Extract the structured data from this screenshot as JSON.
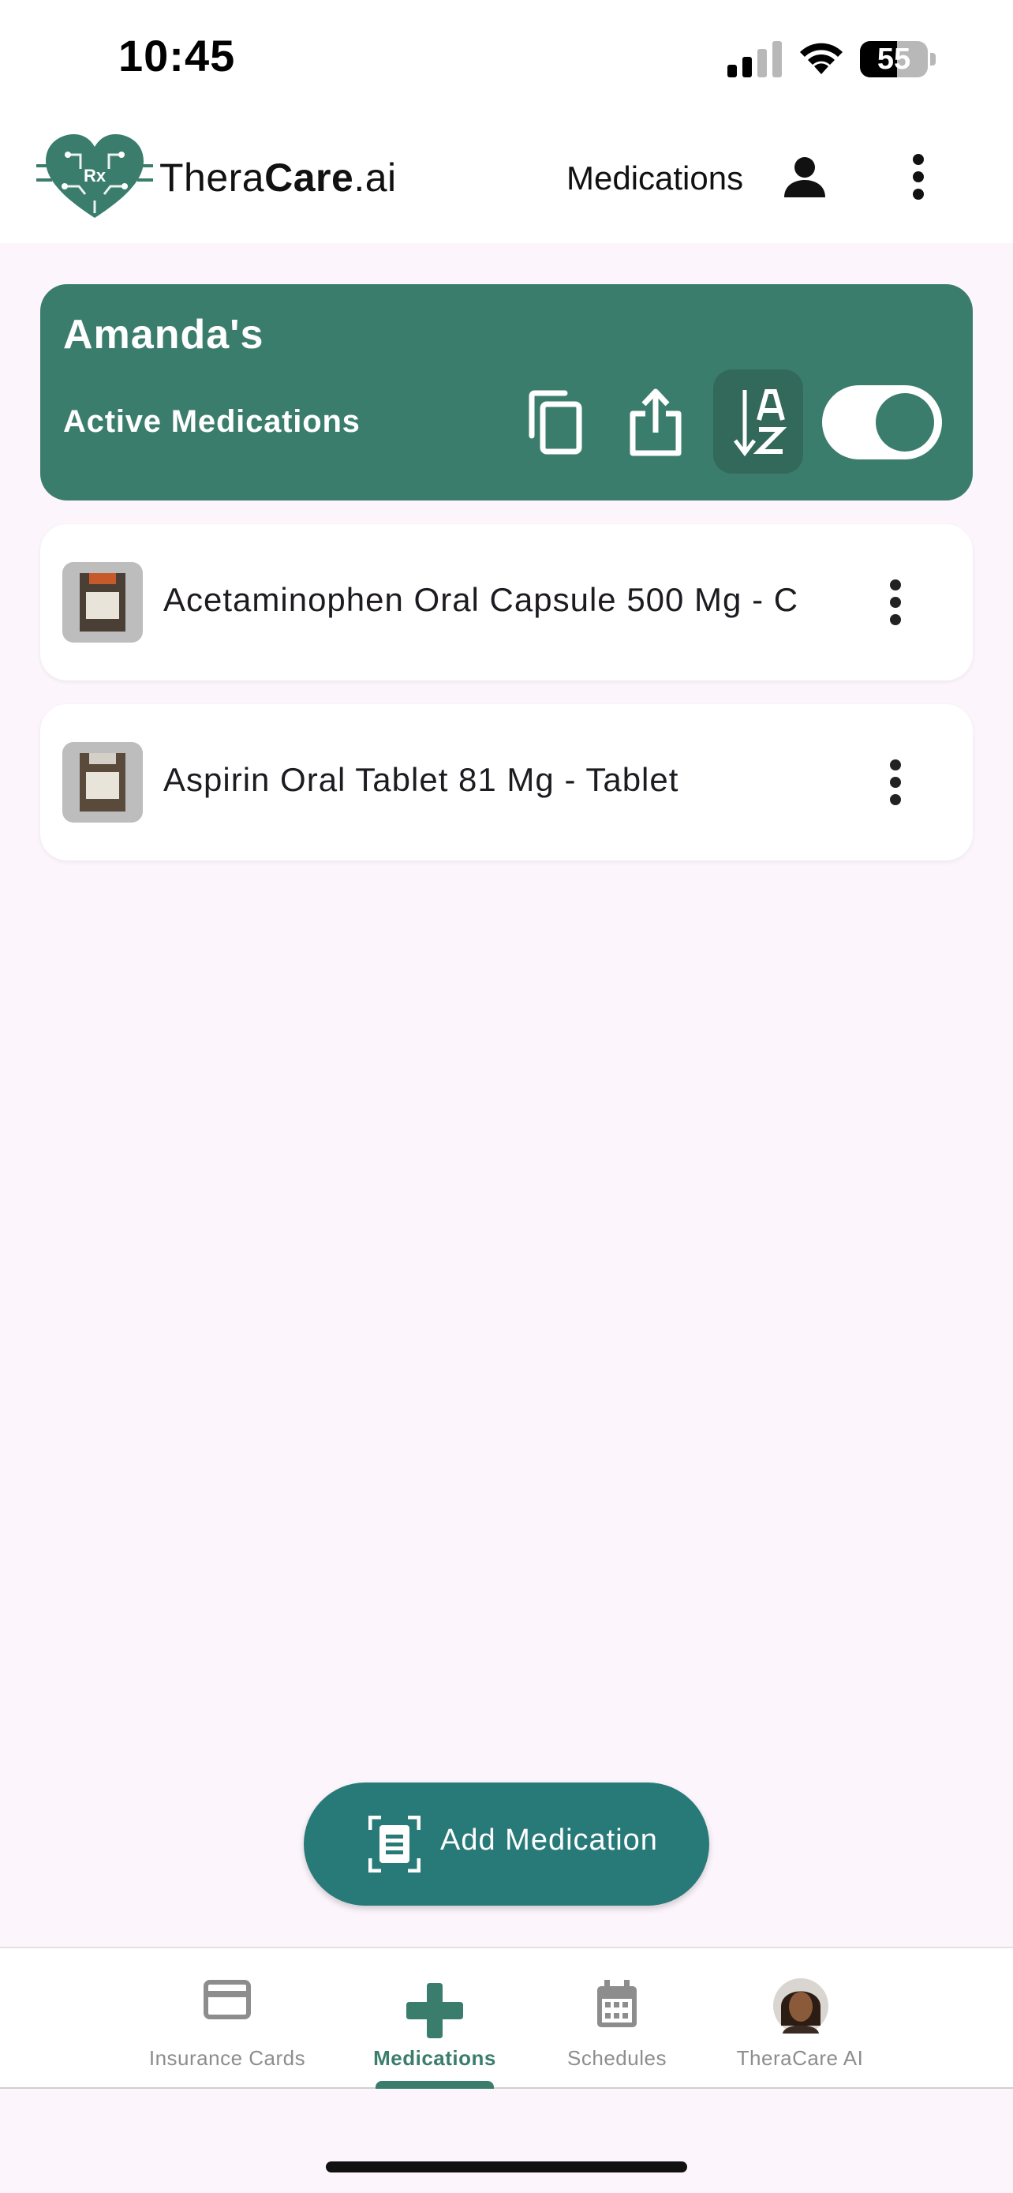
{
  "status_bar": {
    "time": "10:45",
    "battery": "55"
  },
  "app_bar": {
    "brand_prefix": "Thera",
    "brand_bold": "Care",
    "brand_suffix": ".ai",
    "logo_text": "Rx",
    "title": "Medications"
  },
  "header": {
    "owner": "Amanda's",
    "subtitle": "Active Medications",
    "sort_icon": "sort-a-z-icon",
    "active_filter_on": true
  },
  "medications": [
    {
      "name": "Acetaminophen Oral Capsule 500 Mg  - C"
    },
    {
      "name": "Aspirin Oral Tablet 81 Mg  - Tablet"
    }
  ],
  "fab": {
    "label": "Add Medication"
  },
  "bottom_nav": {
    "items": [
      {
        "label": "Insurance Cards",
        "icon": "credit-card-icon"
      },
      {
        "label": "Medications",
        "icon": "medical-cross-icon",
        "active": true
      },
      {
        "label": "Schedules",
        "icon": "calendar-icon"
      },
      {
        "label": "TheraCare AI",
        "icon": "avatar"
      }
    ]
  },
  "colors": {
    "primary": "#3b7d6c",
    "fab": "#277a78",
    "background": "#fcf5fc"
  }
}
